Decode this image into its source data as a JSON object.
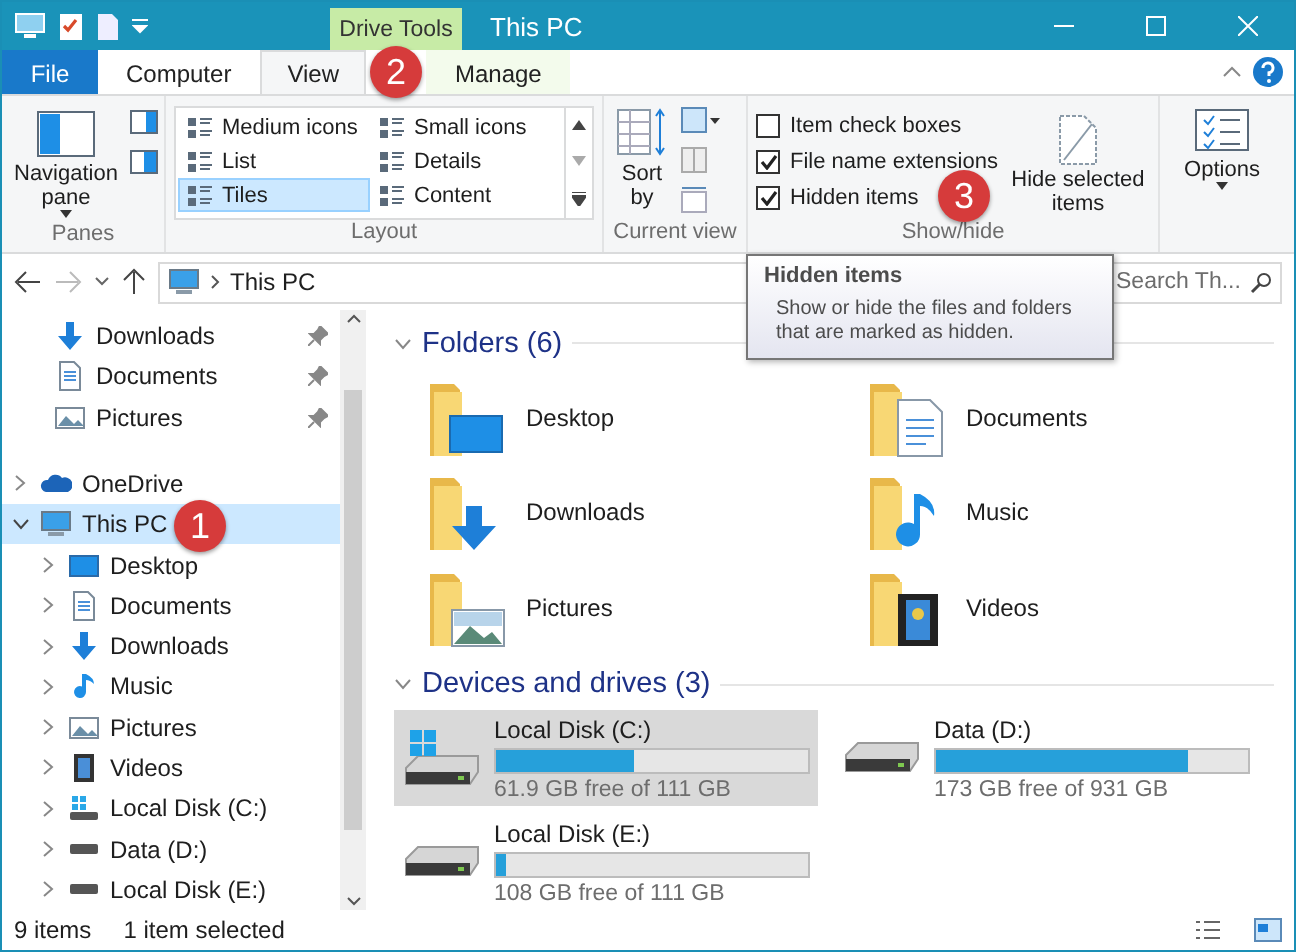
{
  "title_bar": {
    "context_tab": "Drive Tools",
    "title": "This PC"
  },
  "ribbon_tabs": [
    {
      "label": "File",
      "kind": "file",
      "selected": false
    },
    {
      "label": "Computer",
      "kind": "tab",
      "selected": false
    },
    {
      "label": "View",
      "kind": "tab",
      "selected": true
    },
    {
      "label": "Manage",
      "kind": "context",
      "selected": false
    }
  ],
  "ribbon": {
    "panes": {
      "button": "Navigation pane",
      "label": "Panes"
    },
    "layout": {
      "items": [
        {
          "label": "Medium icons",
          "selected": false
        },
        {
          "label": "Small icons",
          "selected": false
        },
        {
          "label": "List",
          "selected": false
        },
        {
          "label": "Details",
          "selected": false
        },
        {
          "label": "Tiles",
          "selected": true
        },
        {
          "label": "Content",
          "selected": false
        }
      ],
      "label": "Layout"
    },
    "current_view": {
      "sort": "Sort by",
      "label": "Current view"
    },
    "show_hide": {
      "checkboxes": [
        {
          "label": "Item check boxes",
          "checked": false
        },
        {
          "label": "File name extensions",
          "checked": true
        },
        {
          "label": "Hidden items",
          "checked": true
        }
      ],
      "hide_selected": "Hide selected items",
      "label": "Show/hide"
    },
    "options": {
      "button": "Options"
    }
  },
  "address": {
    "path": "This PC",
    "search_placeholder": "Search Th..."
  },
  "tooltip": {
    "title": "Hidden items",
    "body": "Show or hide the files and folders that are marked as hidden."
  },
  "nav": {
    "quick_access": [
      {
        "label": "Downloads",
        "kind": "downloads",
        "pinned": true
      },
      {
        "label": "Documents",
        "kind": "documents",
        "pinned": true
      },
      {
        "label": "Pictures",
        "kind": "pictures",
        "pinned": true
      }
    ],
    "items": [
      {
        "label": "OneDrive",
        "kind": "cloud",
        "expanded": false,
        "selected": false
      },
      {
        "label": "This PC",
        "kind": "pc",
        "expanded": true,
        "selected": true,
        "children": [
          {
            "label": "Desktop",
            "kind": "desktop",
            "expanded": false,
            "selected": false
          },
          {
            "label": "Documents",
            "kind": "documents",
            "expanded": false,
            "selected": false
          },
          {
            "label": "Downloads",
            "kind": "downloads",
            "expanded": false,
            "selected": false
          },
          {
            "label": "Music",
            "kind": "music",
            "expanded": false,
            "selected": false
          },
          {
            "label": "Pictures",
            "kind": "pictures",
            "expanded": false,
            "selected": false
          },
          {
            "label": "Videos",
            "kind": "videos",
            "expanded": false,
            "selected": false
          },
          {
            "label": "Local Disk (C:)",
            "kind": "system",
            "expanded": false,
            "selected": false
          },
          {
            "label": "Data (D:)",
            "kind": "drive",
            "expanded": false,
            "selected": false
          },
          {
            "label": "Local Disk (E:)",
            "kind": "drive",
            "expanded": false,
            "selected": false
          }
        ]
      }
    ]
  },
  "folders": {
    "heading": "Folders (6)",
    "items": [
      {
        "label": "Desktop",
        "kind": "desktop"
      },
      {
        "label": "Documents",
        "kind": "documents"
      },
      {
        "label": "Downloads",
        "kind": "downloads"
      },
      {
        "label": "Music",
        "kind": "music"
      },
      {
        "label": "Pictures",
        "kind": "pictures"
      },
      {
        "label": "Videos",
        "kind": "videos"
      }
    ]
  },
  "drives": {
    "heading": "Devices and drives (3)",
    "items": [
      {
        "name": "Local Disk (C:)",
        "free": "61.9 GB free of 111 GB",
        "level": 0.44,
        "kind": "system",
        "selected": true
      },
      {
        "name": "Data (D:)",
        "free": "173 GB free of 931 GB",
        "level": 0.81,
        "kind": "drive",
        "selected": false
      },
      {
        "name": "Local Disk (E:)",
        "free": "108 GB free of 111 GB",
        "level": 0.03,
        "kind": "drive",
        "selected": false
      }
    ]
  },
  "status_bar": [
    "9 items",
    "1 item selected"
  ],
  "markers": [
    "1",
    "2",
    "3"
  ]
}
